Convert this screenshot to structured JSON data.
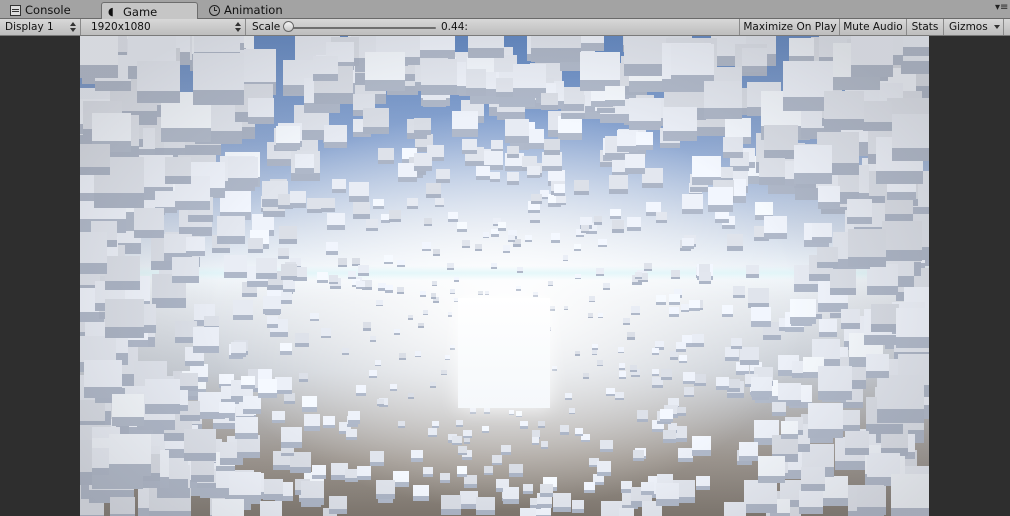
{
  "tabs": [
    {
      "label": "Console",
      "icon": "console-icon",
      "active": false
    },
    {
      "label": "Game",
      "icon": "game-controller-icon",
      "active": true
    },
    {
      "label": "Animation",
      "icon": "clock-icon",
      "active": false
    }
  ],
  "panel_menu_icon": "panel-menu-icon",
  "toolbar": {
    "display": "Display 1",
    "resolution": "1920x1080",
    "scale_label": "Scale",
    "scale_value": "0.44:",
    "scale_fraction": 0.0,
    "maximize_label": "Maximize On Play",
    "mute_label": "Mute Audio",
    "stats_label": "Stats",
    "gizmos_label": "Gizmos"
  },
  "colors": {
    "editor_bg": "#2c2c2c",
    "toolbar_bg": "#c2c2c2",
    "sky_top": "#5d85c2",
    "cube_face": "#eef2f7",
    "ground": "#7c746b"
  }
}
